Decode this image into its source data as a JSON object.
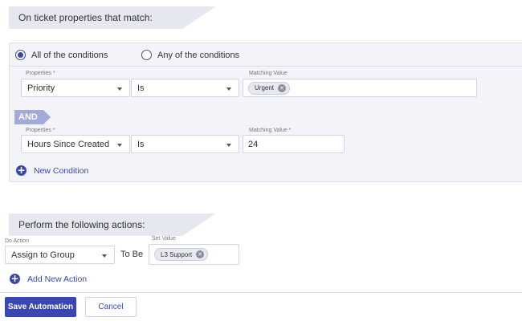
{
  "conditions_section": {
    "title": "On ticket properties that match:",
    "match_mode": {
      "all_label": "All of the conditions",
      "any_label": "Any of the conditions",
      "selected": "all"
    },
    "rows": [
      {
        "property_label": "Properties *",
        "property": "Priority",
        "operator": "Is",
        "value_label": "Matching Value",
        "value_chip": "Urgent"
      },
      {
        "property_label": "Properties *",
        "property": "Hours Since Created",
        "operator": "Is",
        "value_label": "Matching Value *",
        "value": "24"
      }
    ],
    "joiner": "AND",
    "new_condition_label": "New Condition"
  },
  "actions_section": {
    "title": "Perform the following actions:",
    "do_action_label": "Do Action",
    "action": "Assign to Group",
    "to_be_label": "To Be",
    "set_value_label": "Set Value",
    "value_chip": "L3 Support",
    "add_action_label": "Add New Action"
  },
  "footer": {
    "save_label": "Save Automation",
    "cancel_label": "Cancel"
  },
  "colors": {
    "accent": "#3b47b0",
    "and_tag": "#a3aad7",
    "panel_bg": "#f3f4f9",
    "section_tab_bg": "#e6e8ef"
  },
  "icons": {
    "plus": "plus-circle-icon",
    "chip_remove": "close-circle-icon",
    "dropdown": "chevron-down-icon"
  }
}
